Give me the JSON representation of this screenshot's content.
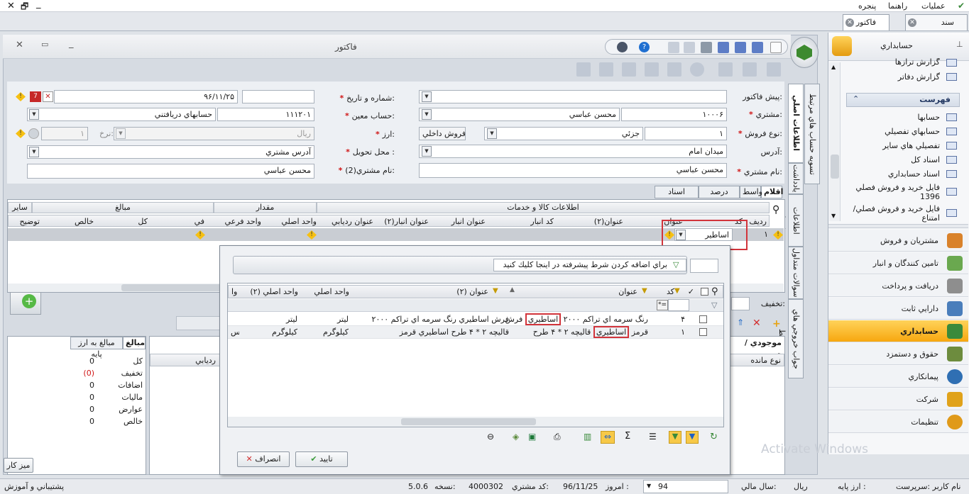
{
  "menubar": {
    "items": [
      "عمليات",
      "راهنما",
      "پنجره"
    ]
  },
  "doc_tabs": [
    {
      "label": "سند حسابداري"
    },
    {
      "label": "فاکتور"
    }
  ],
  "window": {
    "title": "فاکتور"
  },
  "form": {
    "pre_invoice": {
      "label": "پيش فاکتور:",
      "value": ""
    },
    "number_date": {
      "label": "شماره و تاريخ:",
      "number": "",
      "date": "۹۶/۱۱/۲۵"
    },
    "customer": {
      "label": "مشتري:",
      "code": "۱۰۰۰۶",
      "name": "محسن عباسي"
    },
    "moein": {
      "label": "حساب معين:",
      "code": "۱۱۱۲۰۱",
      "name": "حسابهاي دريافتني"
    },
    "sale_type": {
      "label": "نوع فروش:",
      "code": "۱",
      "name": "جزئي",
      "value": "فروش داخلي"
    },
    "currency": {
      "label": "ارز:",
      "value": "ريال",
      "rate_label": "نرخ:",
      "rate": "۱"
    },
    "address": {
      "label": "آدرس:",
      "value": "ميدان امام"
    },
    "delivery": {
      "label": "محل تحويل :",
      "value": "آدرس مشتري"
    },
    "customer_name": {
      "label": "نام مشتري:",
      "value": "محسن عباسي"
    },
    "customer_name2": {
      "label": "نام مشتري(2):",
      "value": "محسن عباسي"
    }
  },
  "subtabs": [
    "اقلام",
    "واسط",
    "درصد سهم",
    "اسناد مرتبط"
  ],
  "vtabs": [
    "اطلاعات اصلي",
    "اطلاعات تكميلي",
    "يادداشت",
    "تسويه حساب هاي مرتبط",
    "سوالات متداول",
    "جواب خروجي هاي مرتبط"
  ],
  "items_grid": {
    "groups": [
      "اطلاعات کالا و خدمات",
      "مقدار",
      "مبالغ",
      "ساير"
    ],
    "columns": [
      "رديف",
      "کد",
      "عنوان",
      "عنوان(۲)",
      "کد انبار",
      "عنوان انبار",
      "عنوان انبار(۲)",
      "عنوان رديابي",
      "واحد اصلي",
      "واحد فرعي",
      "في",
      "کل",
      "خالص",
      "توضيح"
    ],
    "row": {
      "index": "۱",
      "code_value": "اساطير"
    }
  },
  "discount_label": "تخفيف:",
  "amounts": {
    "tabs": [
      "مبالغ",
      "مبالغ به ارز پايه"
    ],
    "rows": [
      {
        "label": "کل",
        "value": "0"
      },
      {
        "label": "تخفيف",
        "value": "(0)"
      },
      {
        "label": "اضافات",
        "value": "0"
      },
      {
        "label": "ماليات",
        "value": "0"
      },
      {
        "label": "عوارض",
        "value": "0"
      },
      {
        "label": "خالص",
        "value": "0"
      }
    ]
  },
  "inventory": {
    "title": "موجودي / قيم",
    "columns": [
      "نوع مانده",
      "رديابي"
    ]
  },
  "popup": {
    "filter_hint": "براي اضافه کردن شرط پيشرفته در اينجا كليك كنيد",
    "columns": [
      "کد",
      "عنوان",
      "عنوان (۲)",
      "واحد اصلي",
      "واحد اصلي (۲)",
      "وا"
    ],
    "search_value": "",
    "rows": [
      {
        "code": "۴",
        "title_pre": "فرش",
        "title_hl": "اساطيري",
        "title_post": "رنگ سرمه اي  تراکم ۲۰۰۰",
        "title2": "فرش اساطيري  رنگ سرمه اي  تراکم ۲۰۰۰",
        "unit": "ليتر",
        "unit2": "ليتر",
        "extra": ""
      },
      {
        "code": "۱",
        "title_pre": "قاليچه ۲ * ۴ طرح",
        "title_hl": "اساطيري",
        "title_post": "قرمز",
        "title2": "قاليچه ۲ * ۴ طرح اساطيري قرمز",
        "unit": "کيلوگرم",
        "unit2": "کيلوگرم",
        "extra": "بس"
      }
    ],
    "ok_label": "تاييد",
    "cancel_label": "انصراف"
  },
  "sidebar": {
    "title": "حسابداري",
    "reports": [
      "گزارش ترازها",
      "گزارش دفاتر"
    ],
    "list_title": "فهرست",
    "list": [
      "حسابها",
      "حسابهاي تفصيلي",
      "تفصيلي هاي ساير",
      "اسناد کل",
      "اسناد حسابداري",
      "فايل خريد و فروش فصلي 1396",
      "فايل خريد و فروش فصلي/امتناع"
    ],
    "nav": [
      {
        "label": "مشتريان و فروش",
        "color": "#d9822b"
      },
      {
        "label": "تامين کنندگان و انبار",
        "color": "#6aa84f"
      },
      {
        "label": "دريافت و پرداخت",
        "color": "#8e8e8e"
      },
      {
        "label": "دارايي ثابت",
        "color": "#4a7ebb"
      },
      {
        "label": "حسابداري",
        "color": "#3b8a3b"
      },
      {
        "label": "حقوق و دستمزد",
        "color": "#6d8c3e"
      },
      {
        "label": "پيمانکاري",
        "color": "#2f6fb3"
      },
      {
        "label": "شرکت",
        "color": "#e0a21a"
      },
      {
        "label": "تنظيمات",
        "color": "#e09a1a"
      }
    ]
  },
  "desk_button": "ميز كار",
  "watermark": "Activate Windows",
  "statusbar": {
    "user": "نام کاربر :سرپرست",
    "base_currency": "ارز پايه :",
    "currency": "ريال",
    "fiscal_year": "سال مالي:",
    "year": "94",
    "today": "امروز :",
    "date": "96/11/25",
    "customer_code": "کد مشتري:",
    "code": "4000302",
    "version_label": "نسخه:",
    "version": "5.0.6",
    "support": "پشتيباني و آموزش"
  }
}
